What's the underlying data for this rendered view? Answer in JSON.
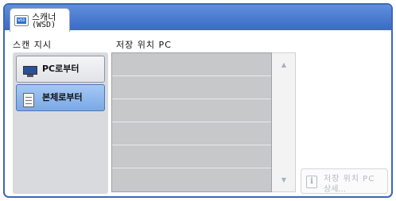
{
  "tab": {
    "line1": "스캐너",
    "line2": "(WSD)",
    "icon": "wsd-scanner-icon"
  },
  "scan_target": {
    "label": "스캔 지시",
    "options": [
      {
        "label": "PC로부터",
        "icon": "pc-monitor-icon",
        "selected": false
      },
      {
        "label": "본체로부터",
        "icon": "device-icon",
        "selected": true
      }
    ]
  },
  "destination": {
    "label": "저장 위치 PC",
    "rows": [
      "",
      "",
      "",
      "",
      "",
      ""
    ]
  },
  "detail_button": {
    "line1": "저장 위치 PC",
    "line2": "상세..."
  },
  "colors": {
    "header": "#3b6ac4",
    "selected": "#7aa9e6",
    "list": "#c7c8ca"
  }
}
